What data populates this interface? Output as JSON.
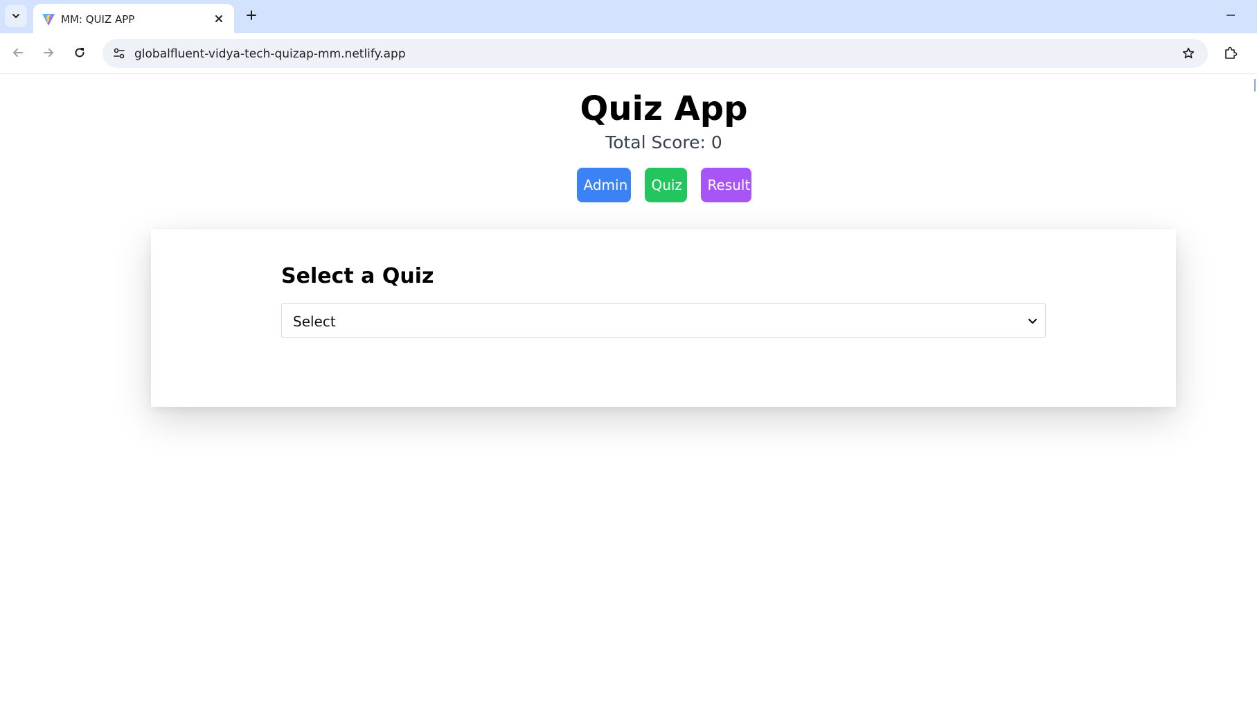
{
  "browser": {
    "tab_title": "MM: QUIZ APP",
    "url": "globalfluent-vidya-tech-quizap-mm.netlify.app",
    "icons": {
      "tab_search": "chevron-down-icon",
      "favicon": "vite-logo-icon",
      "tab_close": "close-icon",
      "new_tab": "plus-icon",
      "minimize": "minimize-icon",
      "back": "arrow-left-icon",
      "forward": "arrow-right-icon",
      "reload": "reload-icon",
      "site_info": "tune-icon",
      "bookmark": "star-icon",
      "extensions": "puzzle-icon"
    }
  },
  "app": {
    "title": "Quiz App",
    "score": "Total Score: 0",
    "nav": {
      "admin": "Admin",
      "quiz": "Quiz",
      "result": "Result"
    },
    "colors": {
      "admin": "#3b82f6",
      "quiz": "#22c55e",
      "result": "#a855f7"
    },
    "quiz_select": {
      "heading": "Select a Quiz",
      "selected_value": "Select"
    }
  }
}
